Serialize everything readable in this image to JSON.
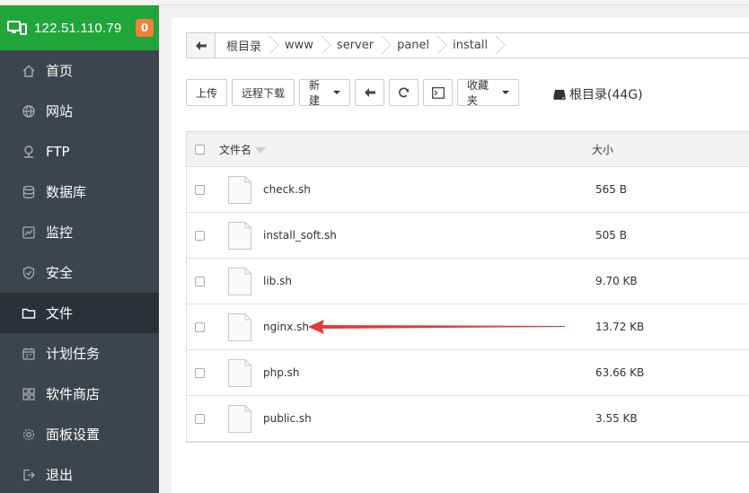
{
  "server": {
    "ip": "122.51.110.79",
    "badge": "0"
  },
  "nav": [
    {
      "label": "首页",
      "icon": "home-icon"
    },
    {
      "label": "网站",
      "icon": "globe-icon"
    },
    {
      "label": "FTP",
      "icon": "ftp-icon"
    },
    {
      "label": "数据库",
      "icon": "database-icon"
    },
    {
      "label": "监控",
      "icon": "monitor-icon"
    },
    {
      "label": "安全",
      "icon": "shield-icon"
    },
    {
      "label": "文件",
      "icon": "folder-icon",
      "active": true
    },
    {
      "label": "计划任务",
      "icon": "calendar-icon"
    },
    {
      "label": "软件商店",
      "icon": "apps-icon"
    },
    {
      "label": "面板设置",
      "icon": "gear-icon"
    },
    {
      "label": "退出",
      "icon": "logout-icon"
    }
  ],
  "breadcrumb": [
    "根目录",
    "www",
    "server",
    "panel",
    "install"
  ],
  "toolbar": {
    "upload": "上传",
    "remote_download": "远程下载",
    "new": "新建",
    "favorites": "收藏夹"
  },
  "disk": {
    "label": "根目录(44G)"
  },
  "table": {
    "col_name": "文件名",
    "col_size": "大小",
    "rows": [
      {
        "name": "check.sh",
        "size": "565 B"
      },
      {
        "name": "install_soft.sh",
        "size": "505 B"
      },
      {
        "name": "lib.sh",
        "size": "9.70 KB"
      },
      {
        "name": "nginx.sh",
        "size": "13.72 KB"
      },
      {
        "name": "php.sh",
        "size": "63.66 KB"
      },
      {
        "name": "public.sh",
        "size": "3.55 KB"
      }
    ]
  },
  "colors": {
    "brand": "#20a53a",
    "sidebar": "#3c444d",
    "badge": "#f57e3a",
    "annotation": "#e53935"
  }
}
